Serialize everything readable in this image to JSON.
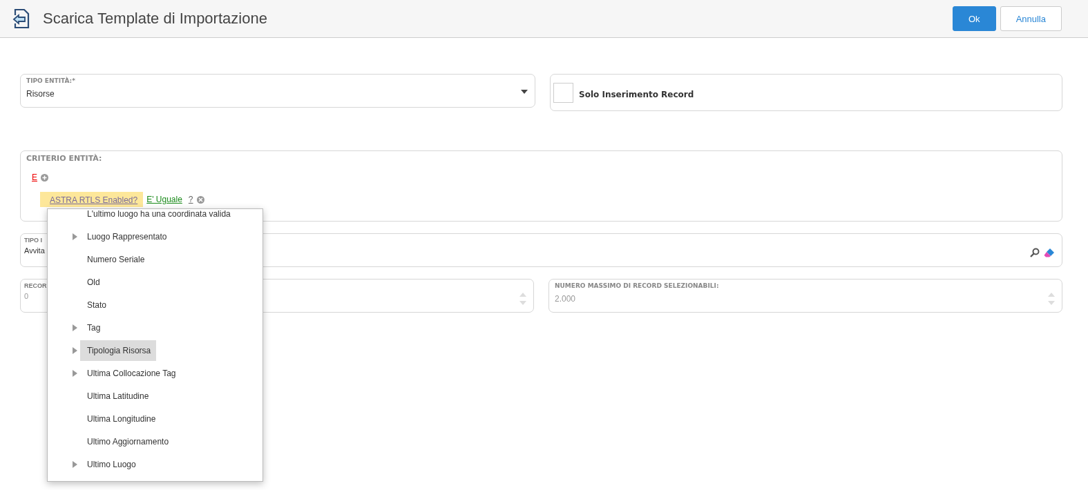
{
  "header": {
    "title": "Scarica Template di Importazione",
    "buttons": [
      {
        "label": "Ok",
        "kind": "primary"
      },
      {
        "label": "Annulla",
        "kind": "secondary"
      }
    ]
  },
  "entity_type": {
    "label": "TIPO ENTITÀ:*",
    "value": "Risorse"
  },
  "insert_only": {
    "label": "Solo Inserimento Record",
    "checked": false
  },
  "criteria": {
    "label": "CRITERIO ENTITÀ:",
    "operator": "E",
    "condition": {
      "field": "ASTRA RTLS Enabled?",
      "comparator": "E' Uguale",
      "value": "?"
    }
  },
  "type_field": {
    "label": "TIPO I",
    "value": "Avvita"
  },
  "records_field": {
    "label": "RECOR",
    "value": "0"
  },
  "max_records": {
    "label": "NUMERO MASSIMO DI RECORD SELEZIONABILI:",
    "value": "2.000"
  },
  "field_menu": [
    {
      "label": "L'ultimo luogo ha una coordinata valida",
      "expandable": false,
      "selected": false
    },
    {
      "label": "Luogo Rappresentato",
      "expandable": true,
      "selected": false
    },
    {
      "label": "Numero Seriale",
      "expandable": false,
      "selected": false
    },
    {
      "label": "Old",
      "expandable": false,
      "selected": false
    },
    {
      "label": "Stato",
      "expandable": false,
      "selected": false
    },
    {
      "label": "Tag",
      "expandable": true,
      "selected": false
    },
    {
      "label": "Tipologia Risorsa",
      "expandable": true,
      "selected": true
    },
    {
      "label": "Ultima Collocazione Tag",
      "expandable": true,
      "selected": false
    },
    {
      "label": "Ultima Latitudine",
      "expandable": false,
      "selected": false
    },
    {
      "label": "Ultima Longitudine",
      "expandable": false,
      "selected": false
    },
    {
      "label": "Ultimo Aggiornamento",
      "expandable": false,
      "selected": false
    },
    {
      "label": "Ultimo Luogo",
      "expandable": true,
      "selected": false
    }
  ]
}
